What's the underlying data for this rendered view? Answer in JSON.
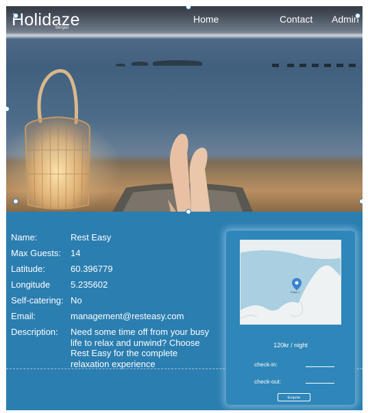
{
  "nav": {
    "logo": "Holidaze",
    "logo_sub": "Bergen",
    "links": [
      "Home",
      "Contact",
      "Admin"
    ]
  },
  "details": {
    "rows": [
      {
        "label": "Name:",
        "value": "Rest Easy"
      },
      {
        "label": "Max Guests:",
        "value": "14"
      },
      {
        "label": "Latitude:",
        "value": "60.396779"
      },
      {
        "label": "Longitude",
        "value": "5.235602"
      },
      {
        "label": "Self-catering:",
        "value": "No"
      },
      {
        "label": "Email:",
        "value": "management@resteasy.com"
      },
      {
        "label": "Description:",
        "value": "Need some time off from your busy life to relax and unwind? Choose Rest Easy for the complete relaxation experience"
      }
    ]
  },
  "card": {
    "price": "120kr / night",
    "checkin_label": "check-in:",
    "checkout_label": "check-out:",
    "enquire_label": "Enquire",
    "map_pin_label": "Pulse 1"
  },
  "colors": {
    "panel": "#2b7eb0",
    "card": "#2f86b8",
    "map_water": "#a9cfe1",
    "map_pin": "#3a82d0"
  },
  "icons": {
    "map_pin": "map-pin-icon"
  }
}
